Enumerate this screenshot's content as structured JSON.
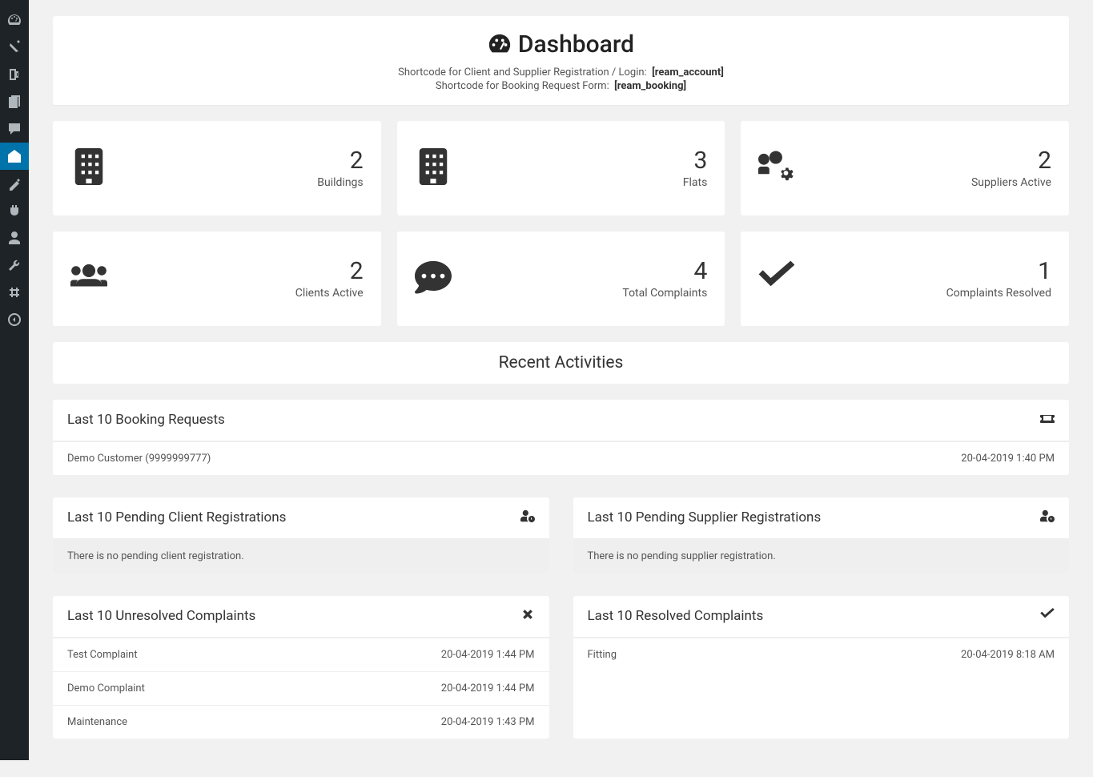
{
  "header": {
    "title": "Dashboard",
    "sub1_label": "Shortcode for Client and Supplier Registration / Login:",
    "sub1_code": "[ream_account]",
    "sub2_label": "Shortcode for Booking Request Form:",
    "sub2_code": "[ream_booking]"
  },
  "stats": [
    {
      "icon": "building",
      "value": "2",
      "label": "Buildings"
    },
    {
      "icon": "building",
      "value": "3",
      "label": "Flats"
    },
    {
      "icon": "users-cog",
      "value": "2",
      "label": "Suppliers Active"
    },
    {
      "icon": "users",
      "value": "2",
      "label": "Clients Active"
    },
    {
      "icon": "comment",
      "value": "4",
      "label": "Total Complaints"
    },
    {
      "icon": "check",
      "value": "1",
      "label": "Complaints Resolved"
    }
  ],
  "recent_title": "Recent Activities",
  "booking": {
    "title": "Last 10 Booking Requests",
    "rows": [
      {
        "left": "Demo Customer (9999999777)",
        "right": "20-04-2019 1:40 PM"
      }
    ]
  },
  "pending_client": {
    "title": "Last 10 Pending Client Registrations",
    "empty": "There is no pending client registration."
  },
  "pending_supplier": {
    "title": "Last 10 Pending Supplier Registrations",
    "empty": "There is no pending supplier registration."
  },
  "unresolved": {
    "title": "Last 10 Unresolved Complaints",
    "rows": [
      {
        "left": "Test Complaint",
        "right": "20-04-2019 1:44 PM"
      },
      {
        "left": "Demo Complaint",
        "right": "20-04-2019 1:44 PM"
      },
      {
        "left": "Maintenance",
        "right": "20-04-2019 1:43 PM"
      }
    ]
  },
  "resolved": {
    "title": "Last 10 Resolved Complaints",
    "rows": [
      {
        "left": "Fitting",
        "right": "20-04-2019 8:18 AM"
      }
    ]
  }
}
